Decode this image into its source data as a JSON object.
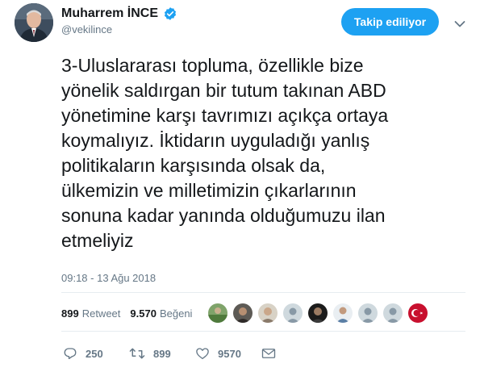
{
  "tweet": {
    "author_name": "Muharrem İNCE",
    "handle": "@vekilince",
    "follow_label": "Takip ediliyor",
    "text": "3-Uluslararası topluma, özellikle bize\nyönelik saldırgan bir tutum takınan ABD\nyönetimine karşı tavrımızı açıkça ortaya\nkoymalıyız. İktidarın uyguladığı yanlış\npolitikaların karşısında olsak da,\nülkemizin ve milletimizin çıkarlarının\nsonuna kadar yanında olduğumuzu ilan\netmeliyiz",
    "timestamp": "09:18 - 13 Ağu 2018"
  },
  "stats": {
    "retweets_count": "899",
    "retweets_label": "Retweet",
    "likes_count": "9.570",
    "likes_label": "Beğeni"
  },
  "actions": {
    "reply_count": "250",
    "retweet_count": "899",
    "like_count": "9570"
  },
  "colors": {
    "accent": "#1da1f2",
    "muted": "#657786",
    "text": "#14171a",
    "divider": "#e6ecf0"
  },
  "icons": [
    "verified-badge-icon",
    "chevron-down-icon",
    "reply-icon",
    "retweet-icon",
    "heart-icon",
    "envelope-icon"
  ]
}
